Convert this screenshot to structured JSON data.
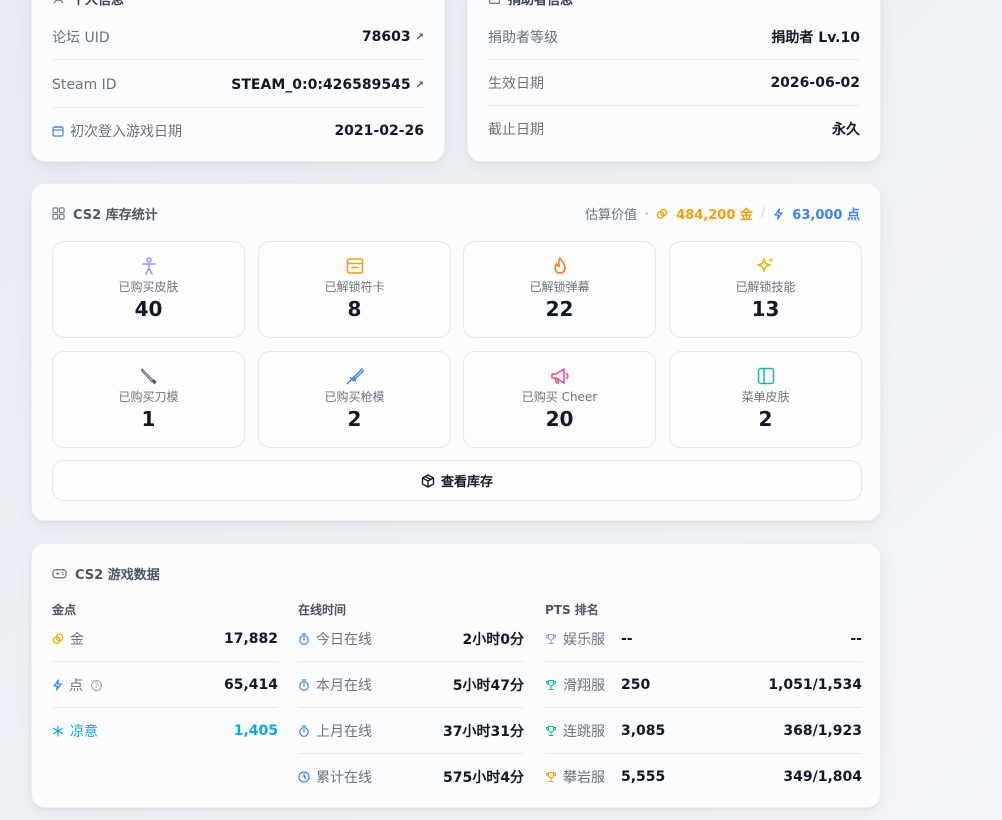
{
  "personal": {
    "title": "个人信息",
    "rows": [
      {
        "label": "论坛 UID",
        "value": "78603"
      },
      {
        "label": "Steam ID",
        "value": "STEAM_0:0:426589545"
      },
      {
        "label": "初次登入游戏日期",
        "value": "2021-02-26"
      }
    ]
  },
  "donor": {
    "title": "捐助者信息",
    "rows": [
      {
        "label": "捐助者等级",
        "value": "捐助者 Lv.10"
      },
      {
        "label": "生效日期",
        "value": "2026-06-02"
      },
      {
        "label": "截止日期",
        "value": "永久"
      }
    ]
  },
  "inventory": {
    "title": "CS2 库存统计",
    "est_label": "估算价值",
    "gold_value": "484,200 金",
    "points_value": "63,000 点",
    "tiles": [
      {
        "label": "已购买皮肤",
        "value": "40",
        "icon": "person-icon",
        "color": "#a78bfa"
      },
      {
        "label": "已解锁符卡",
        "value": "8",
        "icon": "card-icon",
        "color": "#f59e0b"
      },
      {
        "label": "已解锁弹幕",
        "value": "22",
        "icon": "flame-icon",
        "color": "#f97316"
      },
      {
        "label": "已解锁技能",
        "value": "13",
        "icon": "sparkles-icon",
        "color": "#eab308"
      },
      {
        "label": "已购买刀模",
        "value": "1",
        "icon": "knife-icon",
        "color": "#64748b"
      },
      {
        "label": "已购买枪模",
        "value": "2",
        "icon": "rifle-icon",
        "color": "#3b82f6"
      },
      {
        "label": "已购买 Cheer",
        "value": "20",
        "icon": "megaphone-icon",
        "color": "#ec4899"
      },
      {
        "label": "菜单皮肤",
        "value": "2",
        "icon": "panel-icon",
        "color": "#14b8a6"
      }
    ],
    "button_label": "查看库存"
  },
  "game": {
    "title": "CS2 游戏数据",
    "gold": {
      "header": "金点",
      "rows": [
        {
          "label": "金",
          "value": "17,882",
          "icon": "coins-icon",
          "color": "#eab308"
        },
        {
          "label": "点",
          "value": "65,414",
          "icon": "bolt-icon",
          "color": "#3b82f6"
        },
        {
          "label": "凉意",
          "value": "1,405",
          "icon": "snowflake-icon",
          "color": "#0ea5e9"
        }
      ]
    },
    "online": {
      "header": "在线时间",
      "rows": [
        {
          "label": "今日在线",
          "value": "2小时0分"
        },
        {
          "label": "本月在线",
          "value": "5小时47分"
        },
        {
          "label": "上月在线",
          "value": "37小时31分"
        },
        {
          "label": "累计在线",
          "value": "575小时4分"
        }
      ]
    },
    "pts": {
      "header": "PTS 排名",
      "rows": [
        {
          "label": "娱乐服",
          "score": "--",
          "rank": "--",
          "color": "#a78bfa"
        },
        {
          "label": "滑翔服",
          "score": "250",
          "rank": "1,051/1,534",
          "color": "#06b6d4"
        },
        {
          "label": "连跳服",
          "score": "3,085",
          "rank": "368/1,923",
          "color": "#10b981"
        },
        {
          "label": "攀岩服",
          "score": "5,555",
          "rank": "349/1,804",
          "color": "#f59e0b"
        }
      ]
    }
  }
}
